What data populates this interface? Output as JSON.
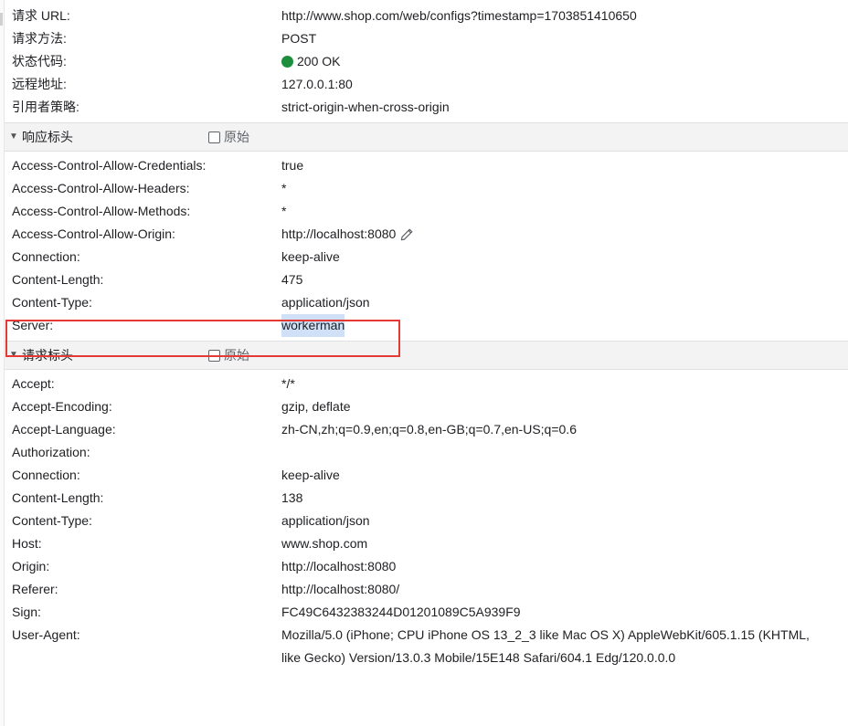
{
  "general": [
    {
      "key": "请求 URL:",
      "value": "http://www.shop.com/web/configs?timestamp=1703851410650"
    },
    {
      "key": "请求方法:",
      "value": "POST"
    },
    {
      "key": "状态代码:",
      "value": "200 OK"
    },
    {
      "key": "远程地址:",
      "value": "127.0.0.1:80"
    },
    {
      "key": "引用者策略:",
      "value": "strict-origin-when-cross-origin"
    }
  ],
  "response_headers": {
    "title": "响应标头",
    "raw_label": "原始",
    "rows": [
      {
        "key": "Access-Control-Allow-Credentials:",
        "value": "true"
      },
      {
        "key": "Access-Control-Allow-Headers:",
        "value": "*"
      },
      {
        "key": "Access-Control-Allow-Methods:",
        "value": "*"
      },
      {
        "key": "Access-Control-Allow-Origin:",
        "value": "http://localhost:8080"
      },
      {
        "key": "Connection:",
        "value": "keep-alive"
      },
      {
        "key": "Content-Length:",
        "value": "475"
      },
      {
        "key": "Content-Type:",
        "value": "application/json"
      },
      {
        "key": "Server:",
        "value": "workerman"
      }
    ]
  },
  "request_headers": {
    "title": "请求标头",
    "raw_label": "原始",
    "rows": [
      {
        "key": "Accept:",
        "value": "*/*"
      },
      {
        "key": "Accept-Encoding:",
        "value": "gzip, deflate"
      },
      {
        "key": "Accept-Language:",
        "value": "zh-CN,zh;q=0.9,en;q=0.8,en-GB;q=0.7,en-US;q=0.6"
      },
      {
        "key": "Authorization:",
        "value": ""
      },
      {
        "key": "Connection:",
        "value": "keep-alive"
      },
      {
        "key": "Content-Length:",
        "value": "138"
      },
      {
        "key": "Content-Type:",
        "value": "application/json"
      },
      {
        "key": "Host:",
        "value": "www.shop.com"
      },
      {
        "key": "Origin:",
        "value": "http://localhost:8080"
      },
      {
        "key": "Referer:",
        "value": "http://localhost:8080/"
      },
      {
        "key": "Sign:",
        "value": "FC49C6432383244D01201089C5A939F9"
      },
      {
        "key": "User-Agent:",
        "value": "Mozilla/5.0 (iPhone; CPU iPhone OS 13_2_3 like Mac OS X) AppleWebKit/605.1.15 (KHTML, like Gecko) Version/13.0.3 Mobile/15E148 Safari/604.1 Edg/120.0.0.0"
      }
    ]
  },
  "colors": {
    "status_ok": "#1e8e3e",
    "selection_highlight": "#cfe0f7",
    "annotation_box": "#e53935"
  },
  "icons": {
    "status": "status-dot-icon",
    "edit": "pencil-icon",
    "collapse": "triangle-down-icon"
  }
}
